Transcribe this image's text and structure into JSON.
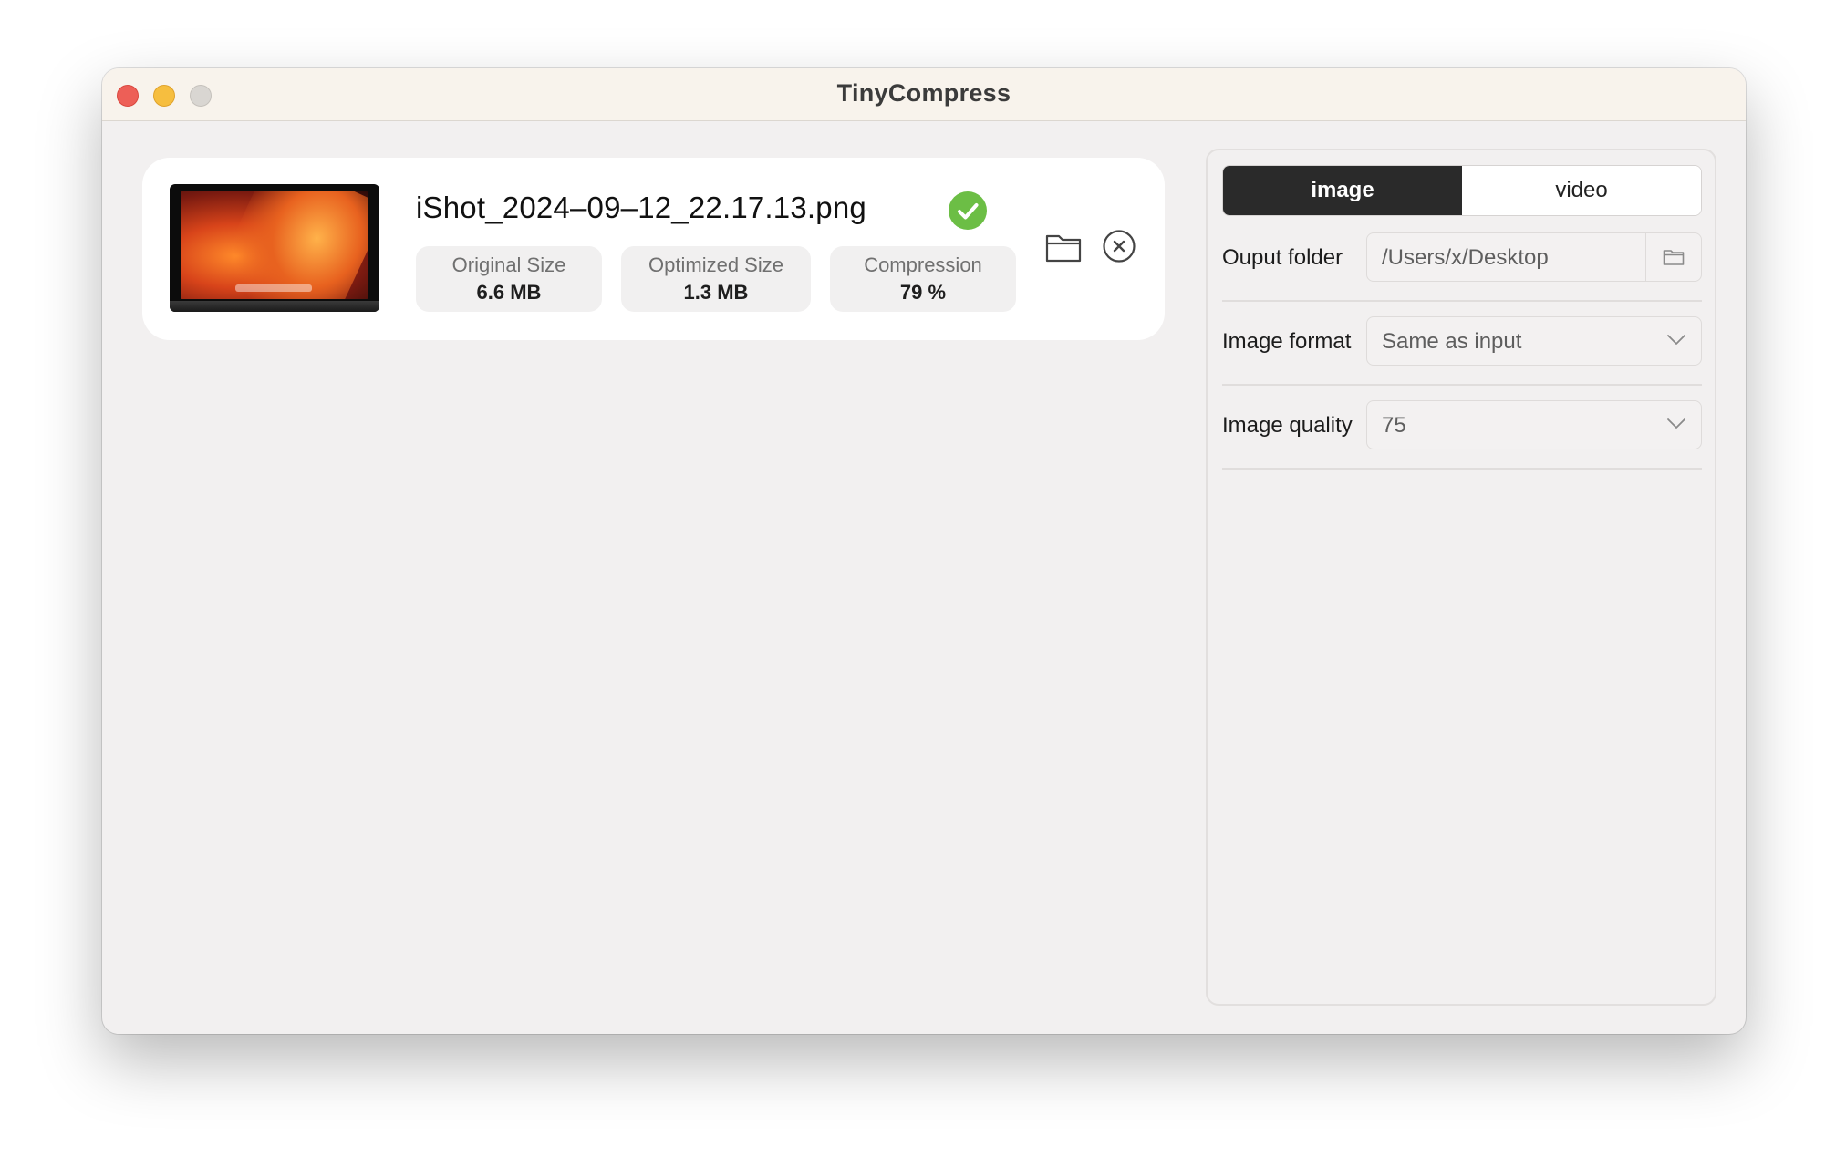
{
  "window": {
    "title": "TinyCompress"
  },
  "file": {
    "name": "iShot_2024–09–12_22.17.13.png",
    "stats": [
      {
        "label": "Original Size",
        "value": "6.6 MB"
      },
      {
        "label": "Optimized Size",
        "value": "1.3 MB"
      },
      {
        "label": "Compression",
        "value": "79 %"
      }
    ],
    "icons": {
      "status": "check-circle-icon",
      "open": "folder-icon",
      "remove": "close-circle-icon"
    }
  },
  "settings": {
    "tabs": [
      {
        "label": "image",
        "active": true
      },
      {
        "label": "video",
        "active": false
      }
    ],
    "output_folder": {
      "label": "Ouput folder",
      "value": "/Users/x/Desktop"
    },
    "image_format": {
      "label": "Image format",
      "value": "Same as input"
    },
    "image_quality": {
      "label": "Image quality",
      "value": "75"
    }
  },
  "colors": {
    "success": "#6cbe45",
    "tab_active": "#2a2a2a",
    "close": "#ed5f57",
    "minimize": "#f6be3f"
  }
}
